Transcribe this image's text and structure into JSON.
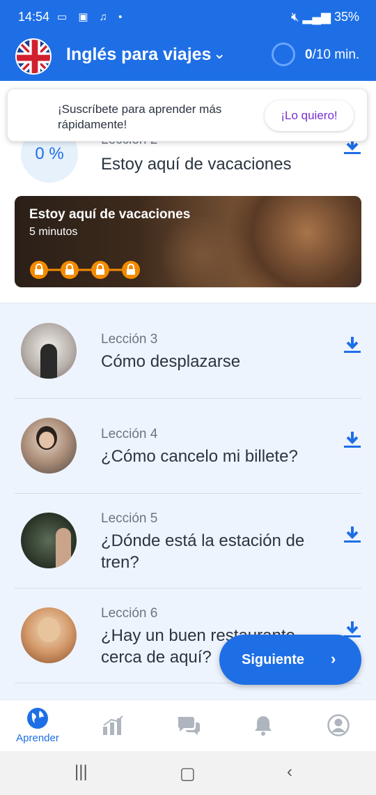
{
  "status_bar": {
    "time": "14:54",
    "battery": "35%"
  },
  "header": {
    "course_title": "Inglés para viajes",
    "minutes_done": "0",
    "minutes_total": "/10 min."
  },
  "subscribe": {
    "text": "¡Suscríbete para aprender más rápidamente!",
    "button": "¡Lo quiero!"
  },
  "current_lesson": {
    "progress": "0 %",
    "label": "Lección 2",
    "title": "Estoy aquí de vacaciones",
    "banner_title": "Estoy aquí de vacaciones",
    "banner_duration": "5 minutos",
    "locked_steps": 4
  },
  "lessons": [
    {
      "label": "Lección 3",
      "title": "Cómo desplazarse"
    },
    {
      "label": "Lección 4",
      "title": "¿Cómo cancelo mi billete?"
    },
    {
      "label": "Lección 5",
      "title": "¿Dónde está la estación de tren?"
    },
    {
      "label": "Lección 6",
      "title": "¿Hay un buen restaurante cerca de aquí?"
    }
  ],
  "next_button": "Siguiente",
  "bottom_nav": {
    "items": [
      {
        "icon": "globe-icon",
        "label": "Aprender",
        "active": true
      },
      {
        "icon": "stats-icon"
      },
      {
        "icon": "chat-icon"
      },
      {
        "icon": "bell-icon"
      },
      {
        "icon": "profile-icon"
      }
    ]
  },
  "colors": {
    "brand": "#1e6fe6",
    "accent_purple": "#7a2fcf",
    "lock_orange": "#f28a00",
    "list_bg": "#eef4fd"
  }
}
